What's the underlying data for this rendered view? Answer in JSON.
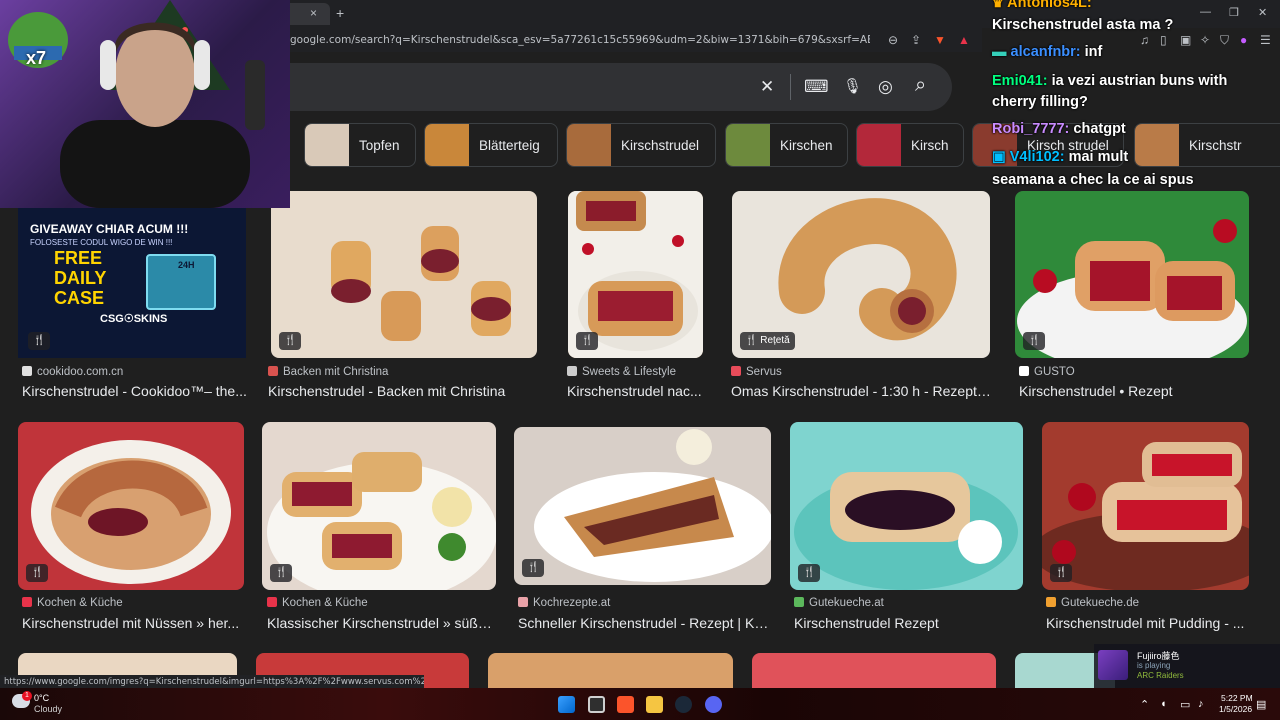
{
  "browser": {
    "tab_close": "×",
    "new_tab": "+",
    "url": "google.com/search?q=Kirschenstrudel&sca_esv=5a77261c15c55969&udm=2&biw=1371&bih=679&sxsrf=AE3TifM-GZ1SZfZ7QJG-dW6aSAQ...",
    "window_controls": [
      "—",
      "❐",
      "✕"
    ]
  },
  "search": {
    "clear_icon": "✕",
    "keyboard_icon": "⌨",
    "mic_icon": "🎙",
    "lens_icon": "◎",
    "search_icon": "⌕"
  },
  "chips": [
    {
      "label": "Topfen",
      "color": "#d9c9b8"
    },
    {
      "label": "Blätterteig",
      "color": "#c9873a"
    },
    {
      "label": "Kirschstrudel",
      "color": "#a86b3c"
    },
    {
      "label": "Kirschen",
      "color": "#6d8a3d"
    },
    {
      "label": "Kirsch",
      "color": "#b3283a"
    },
    {
      "label": "Kirsch strudel",
      "color": "#8a3b2e"
    },
    {
      "label": "Kirschstr",
      "color": "#b97b48"
    }
  ],
  "results_row1": [
    {
      "badge": "🍴",
      "source": "cookidoo.com.cn",
      "title": "Kirschenstrudel - Cookidoo™– the...",
      "fav": "#e0e0e0",
      "bg": "#e6d9c9"
    },
    {
      "badge": "🍴",
      "source": "Backen mit Christina",
      "title": "Kirschenstrudel - Backen mit Christina",
      "fav": "#d9534f",
      "bg": "#e8dccd"
    },
    {
      "badge": "🍴",
      "source": "Sweets & Lifestyle",
      "title": "Kirschenstrudel nac...",
      "fav": "#cccccc",
      "bg": "#c98f5a"
    },
    {
      "badge": "🍴 Rețetă",
      "source": "Servus",
      "title": "Omas Kirschenstrudel - 1:30 h - Rezept -...",
      "fav": "#e84c5a",
      "bg": "#c8a27a"
    },
    {
      "badge": "🍴",
      "source": "GUSTO",
      "title": "Kirschenstrudel • Rezept",
      "fav": "#ffffff",
      "bg": "#2f8a3a"
    }
  ],
  "results_row2": [
    {
      "badge": "🍴",
      "source": "Kochen & Küche",
      "title": "Kirschenstrudel mit Nüssen » her...",
      "fav": "#e8334a",
      "bg": "#c0343a"
    },
    {
      "badge": "🍴",
      "source": "Kochen & Küche",
      "title": "Klassischer Kirschenstrudel » süße...",
      "fav": "#e8334a",
      "bg": "#e4d8cf"
    },
    {
      "badge": "🍴",
      "source": "Kochrezepte.at",
      "title": "Schneller Kirschenstrudel - Rezept | Ko...",
      "fav": "#e9a2a8",
      "bg": "#d8cfc8"
    },
    {
      "badge": "🍴",
      "source": "Gutekueche.at",
      "title": "Kirschenstrudel Rezept",
      "fav": "#5cb85c",
      "bg": "#7fd4cf"
    },
    {
      "badge": "🍴",
      "source": "Gutekueche.de",
      "title": "Kirschenstrudel mit Pudding - ...",
      "fav": "#f0a030",
      "bg": "#a33b2e"
    }
  ],
  "promo": {
    "line1": "GIVEAWAY CHIAR ACUM !!!",
    "line2": "FOLOSESTE CODUL WIGO DE WIN !!!",
    "free": "FREE",
    "daily": "DAILY",
    "case": "CASE",
    "brand": "CSG☉SKINS",
    "box_label": "24H"
  },
  "webcam": {
    "emote_label": "x7"
  },
  "chat": [
    {
      "user": "Antonios4L:",
      "color": "#ffb000",
      "text": ""
    },
    {
      "user": "",
      "color": "#ffffff",
      "text": "Kirschenstrudel asta ma ?"
    },
    {
      "user": "alcanfnbr:",
      "color": "#3b8fff",
      "text": "inf"
    },
    {
      "user": "Emi041:",
      "color": "#00ff7f",
      "text": "ia vezi austrian buns with"
    },
    {
      "user": "",
      "color": "#ffffff",
      "text": "cherry filling?"
    },
    {
      "user": "Robi_7777:",
      "color": "#c98bff",
      "text": "chatgpt"
    },
    {
      "user": "V4li102:",
      "color": "#00bfff",
      "text": "mai mult"
    },
    {
      "user": "",
      "color": "#ffffff",
      "text": "seamana a chec la ce ai spus"
    }
  ],
  "status_url": "https://www.google.com/imgres?q=Kirschenstrudel&imgurl=https%3A%2F%2Fwww.servus.com%2Fstorage%2Frecip...",
  "notification": {
    "name": "Fujiiro藤色",
    "status": "is playing",
    "game": "ARC Raiders"
  },
  "taskbar": {
    "weather_temp": "0°C",
    "weather_desc": "Cloudy",
    "weather_badge": "1",
    "time": "5:22 PM",
    "date": "1/5/2026"
  }
}
